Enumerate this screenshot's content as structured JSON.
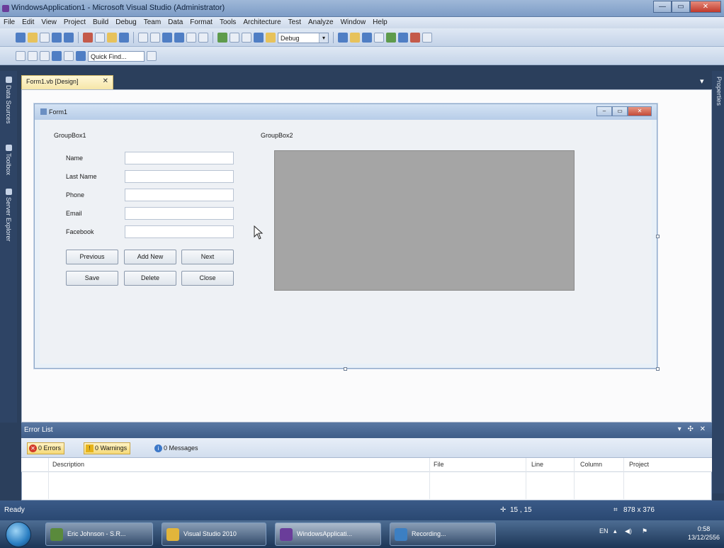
{
  "window": {
    "title": "WindowsApplication1 - Microsoft Visual Studio (Administrator)",
    "buttons": {
      "minimize": "—",
      "maximize": "▭",
      "close": "✕"
    }
  },
  "menu": [
    "File",
    "Edit",
    "View",
    "Project",
    "Build",
    "Debug",
    "Team",
    "Data",
    "Format",
    "Tools",
    "Architecture",
    "Test",
    "Analyze",
    "Window",
    "Help"
  ],
  "toolbar": {
    "config": "Debug",
    "quick_find": "Quick Find..."
  },
  "side_tabs": [
    "Data Sources",
    "Toolbox",
    "Server Explorer"
  ],
  "right_tab": "Properties",
  "doc_tab": {
    "label": "Form1.vb [Design]",
    "close": "✕",
    "pin": "▾"
  },
  "form": {
    "title": "Form1",
    "groupbox1": "GroupBox1",
    "groupbox2": "GroupBox2",
    "fields": [
      {
        "label": "Name"
      },
      {
        "label": "Last Name"
      },
      {
        "label": "Phone"
      },
      {
        "label": "Email"
      },
      {
        "label": "Facebook"
      }
    ],
    "buttons_row1": [
      "Previous",
      "Add New",
      "Next"
    ],
    "buttons_row2": [
      "Save",
      "Delete",
      "Close"
    ]
  },
  "error_list": {
    "title": "Error List",
    "controls": "▾ ✣ ✕",
    "errors": "0 Errors",
    "warnings": "0 Warnings",
    "messages": "0 Messages",
    "columns": [
      "Description",
      "File",
      "Line",
      "Column",
      "Project"
    ]
  },
  "status": {
    "ready": "Ready",
    "position": "15 , 15",
    "size": "878 x 376"
  },
  "taskbar": {
    "items": [
      "Eric Johnson - S.R...",
      "Visual Studio 2010",
      "WindowsApplicati...",
      "Recording..."
    ],
    "lang": "EN",
    "time": "0:58",
    "date": "13/12/2556"
  }
}
